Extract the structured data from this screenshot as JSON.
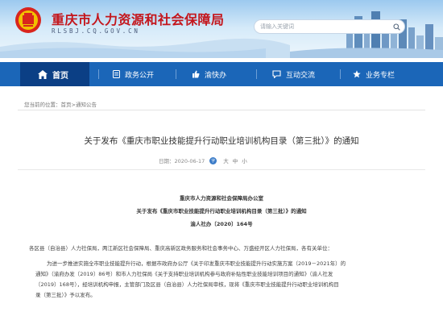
{
  "header": {
    "title": "重庆市人力资源和社会保障局",
    "domain": "RLSBJ.CQ.GOV.CN",
    "search_placeholder": "请输入关键词"
  },
  "nav": {
    "items": [
      {
        "label": "首页",
        "icon": "home-icon",
        "active": true
      },
      {
        "label": "政务公开",
        "icon": "document-icon"
      },
      {
        "label": "渝快办",
        "icon": "thumbs-up-icon"
      },
      {
        "label": "互动交流",
        "icon": "chat-icon"
      },
      {
        "label": "业务专栏",
        "icon": "star-icon"
      }
    ]
  },
  "breadcrumb": {
    "prefix": "您当前的位置：",
    "home": "首页",
    "sep": ">",
    "current": "通知公告"
  },
  "article": {
    "title": "关于发布《重庆市职业技能提升行动职业培训机构目录（第三批）》的通知",
    "date": "日期：2020-06-17",
    "font_label": "字",
    "sizes": [
      "大",
      "中",
      "小"
    ],
    "doc_office": "重庆市人力资源和社会保障局办公室",
    "doc_title": "关于发布《重庆市职业技能提升行动职业培训机构目录（第三批）》的通知",
    "doc_number": "渝人社办〔2020〕164号",
    "salutation": "各区县（自治县）人力社保局，两江新区社会保障局、重庆高新区政务服务和社会事务中心、万盛经开区人力社保局，各有关单位：",
    "para_lines": [
      "为进一步推进实施全市职业技能提升行动，根据市政府办公厅《关于印发重庆市职业技能提升行动实施方案（2019－2021年）的",
      "通知》（渝府办发〔2019〕86号）和市人力社保局《关于支持职业培训机构参与政府补贴性职业技能培训项目的通知》（渝人社发",
      "〔2019〕168号），经培训机构申报，主管部门及区县（自治县）人力社保局审核，现将《重庆市职业技能提升行动职业培训机构目",
      "录（第三批）》予以发布。"
    ]
  }
}
